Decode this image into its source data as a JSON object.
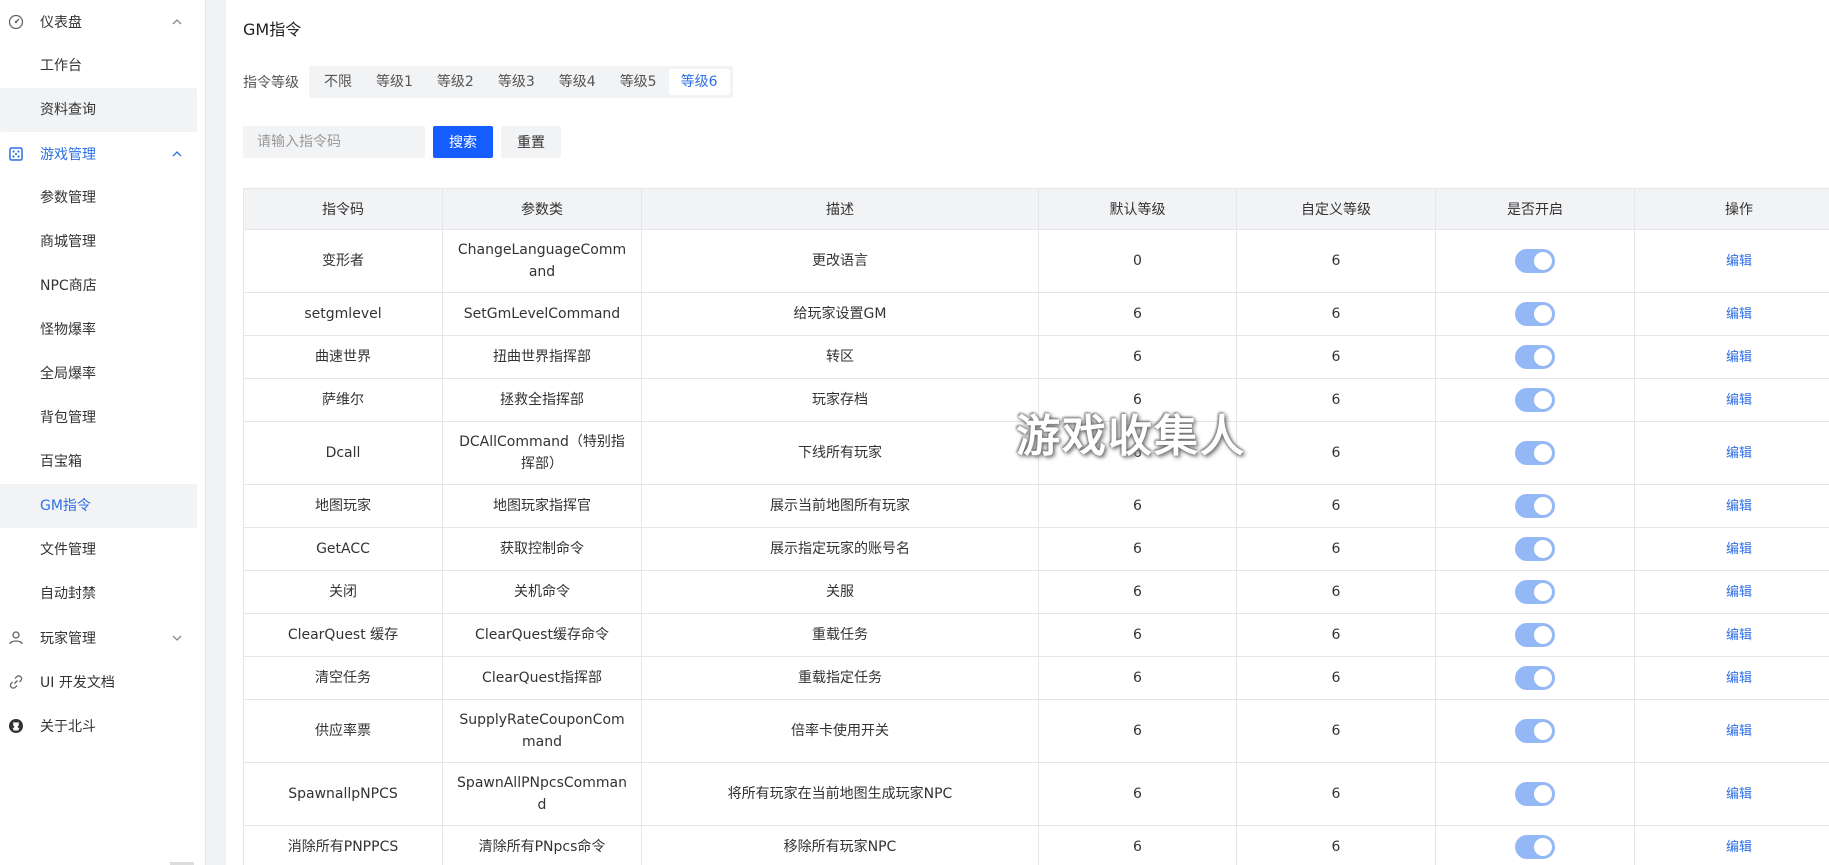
{
  "sidebar": {
    "groups": [
      {
        "label": "仪表盘",
        "icon": "dashboard-icon",
        "items": [
          "工作台",
          "资料查询"
        ]
      },
      {
        "label": "游戏管理",
        "icon": "dice-icon",
        "items": [
          "参数管理",
          "商城管理",
          "NPC商店",
          "怪物爆率",
          "全局爆率",
          "背包管理",
          "百宝箱",
          "GM指令",
          "文件管理",
          "自动封禁"
        ]
      },
      {
        "label": "玩家管理",
        "icon": "user-icon"
      },
      {
        "label": "UI 开发文档",
        "icon": "link-icon"
      },
      {
        "label": "关于北斗",
        "icon": "github-icon"
      }
    ]
  },
  "page": {
    "title": "GM指令",
    "level_label": "指令等级",
    "level_tabs": [
      "不限",
      "等级1",
      "等级2",
      "等级3",
      "等级4",
      "等级5",
      "等级6"
    ],
    "active_level": "等级6",
    "search_placeholder": "请输入指令码",
    "search_value": "",
    "search_button": "搜索",
    "reset_button": "重置"
  },
  "table": {
    "columns": [
      "指令码",
      "参数类",
      "描述",
      "默认等级",
      "自定义等级",
      "是否开启",
      "操作"
    ],
    "edit_label": "编辑",
    "rows": [
      {
        "code": "变形者",
        "param": "ChangeLanguageCommand",
        "desc": "更改语言",
        "default_level": "0",
        "custom_level": "6",
        "enabled": true
      },
      {
        "code": "setgmlevel",
        "param": "SetGmLevelCommand",
        "desc": "给玩家设置GM",
        "default_level": "6",
        "custom_level": "6",
        "enabled": true
      },
      {
        "code": "曲速世界",
        "param": "扭曲世界指挥部",
        "desc": "转区",
        "default_level": "6",
        "custom_level": "6",
        "enabled": true
      },
      {
        "code": "萨维尔",
        "param": "拯救全指挥部",
        "desc": "玩家存档",
        "default_level": "6",
        "custom_level": "6",
        "enabled": true
      },
      {
        "code": "Dcall",
        "param": "DCAllCommand（特别指挥部）",
        "desc": "下线所有玩家",
        "default_level": "6",
        "custom_level": "6",
        "enabled": true
      },
      {
        "code": "地图玩家",
        "param": "地图玩家指挥官",
        "desc": "展示当前地图所有玩家",
        "default_level": "6",
        "custom_level": "6",
        "enabled": true
      },
      {
        "code": "GetACC",
        "param": "获取控制命令",
        "desc": "展示指定玩家的账号名",
        "default_level": "6",
        "custom_level": "6",
        "enabled": true
      },
      {
        "code": "关闭",
        "param": "关机命令",
        "desc": "关服",
        "default_level": "6",
        "custom_level": "6",
        "enabled": true
      },
      {
        "code": "ClearQuest 缓存",
        "param": "ClearQuest缓存命令",
        "desc": "重载任务",
        "default_level": "6",
        "custom_level": "6",
        "enabled": true
      },
      {
        "code": "清空任务",
        "param": "ClearQuest指挥部",
        "desc": "重载指定任务",
        "default_level": "6",
        "custom_level": "6",
        "enabled": true
      },
      {
        "code": "供应率票",
        "param": "SupplyRateCouponCommand",
        "desc": "倍率卡使用开关",
        "default_level": "6",
        "custom_level": "6",
        "enabled": true
      },
      {
        "code": "SpawnallpNPCS",
        "param": "SpawnAllPNpcsCommand",
        "desc": "将所有玩家在当前地图生成玩家NPC",
        "default_level": "6",
        "custom_level": "6",
        "enabled": true
      },
      {
        "code": "消除所有PNPPCS",
        "param": "清除所有PNpcs命令",
        "desc": "移除所有玩家NPC",
        "default_level": "6",
        "custom_level": "6",
        "enabled": true
      }
    ]
  },
  "watermark": "游戏收集人",
  "colors": {
    "accent": "#2f6fe6",
    "primary_button": "#165dff",
    "switch_on": "#94b8f5"
  }
}
